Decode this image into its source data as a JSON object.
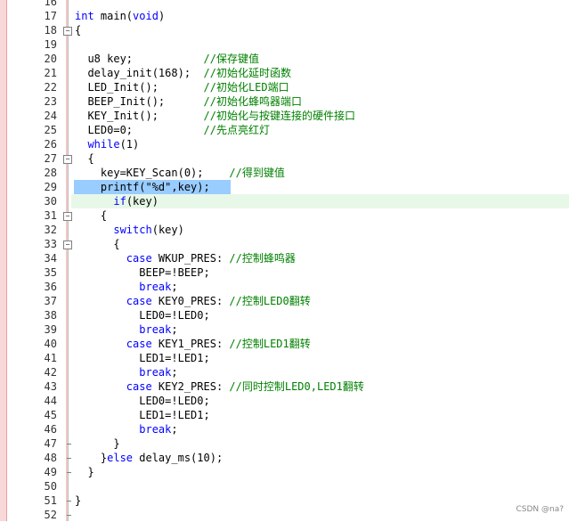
{
  "editor": {
    "lines": [
      {
        "n": "16",
        "fold": "",
        "parts": []
      },
      {
        "n": "17",
        "fold": "",
        "parts": [
          [
            "kw",
            "int"
          ],
          [
            "t",
            " main("
          ],
          [
            "kw",
            "void"
          ],
          [
            "t",
            ")"
          ]
        ]
      },
      {
        "n": "18",
        "fold": "box",
        "parts": [
          [
            "t",
            "{"
          ]
        ]
      },
      {
        "n": "19",
        "fold": "",
        "parts": []
      },
      {
        "n": "20",
        "fold": "",
        "parts": [
          [
            "t",
            "  u8 key;           "
          ],
          [
            "cm",
            "//保存键值"
          ]
        ]
      },
      {
        "n": "21",
        "fold": "",
        "parts": [
          [
            "t",
            "  delay_init(168);  "
          ],
          [
            "cm",
            "//初始化延时函数"
          ]
        ]
      },
      {
        "n": "22",
        "fold": "",
        "parts": [
          [
            "t",
            "  LED_Init();       "
          ],
          [
            "cm",
            "//初始化LED端口"
          ]
        ]
      },
      {
        "n": "23",
        "fold": "",
        "parts": [
          [
            "t",
            "  BEEP_Init();      "
          ],
          [
            "cm",
            "//初始化蜂鸣器端口"
          ]
        ]
      },
      {
        "n": "24",
        "fold": "",
        "parts": [
          [
            "t",
            "  KEY_Init();       "
          ],
          [
            "cm",
            "//初始化与按键连接的硬件接口"
          ]
        ]
      },
      {
        "n": "25",
        "fold": "",
        "parts": [
          [
            "t",
            "  LED0=0;           "
          ],
          [
            "cm",
            "//先点亮红灯"
          ]
        ]
      },
      {
        "n": "26",
        "fold": "",
        "parts": [
          [
            "t",
            "  "
          ],
          [
            "kw",
            "while"
          ],
          [
            "t",
            "(1)"
          ]
        ]
      },
      {
        "n": "27",
        "fold": "box",
        "parts": [
          [
            "t",
            "  {"
          ]
        ]
      },
      {
        "n": "28",
        "fold": "",
        "parts": [
          [
            "t",
            "    key=KEY_Scan(0);    "
          ],
          [
            "cm",
            "//得到键值"
          ]
        ]
      },
      {
        "n": "29",
        "fold": "",
        "parts": [
          [
            "t",
            "    printf(\"%d\",key);"
          ]
        ]
      },
      {
        "n": "30",
        "fold": "",
        "parts": [
          [
            "t",
            "      "
          ],
          [
            "kw",
            "if"
          ],
          [
            "t",
            "(key)"
          ]
        ]
      },
      {
        "n": "31",
        "fold": "box",
        "parts": [
          [
            "t",
            "    {"
          ]
        ]
      },
      {
        "n": "32",
        "fold": "",
        "parts": [
          [
            "t",
            "      "
          ],
          [
            "kw",
            "switch"
          ],
          [
            "t",
            "(key)"
          ]
        ]
      },
      {
        "n": "33",
        "fold": "box",
        "parts": [
          [
            "t",
            "      {"
          ]
        ]
      },
      {
        "n": "34",
        "fold": "",
        "parts": [
          [
            "t",
            "        "
          ],
          [
            "kw",
            "case"
          ],
          [
            "t",
            " WKUP_PRES: "
          ],
          [
            "cm",
            "//控制蜂鸣器"
          ]
        ]
      },
      {
        "n": "35",
        "fold": "",
        "parts": [
          [
            "t",
            "          BEEP=!BEEP;"
          ]
        ]
      },
      {
        "n": "36",
        "fold": "",
        "parts": [
          [
            "t",
            "          "
          ],
          [
            "kw",
            "break"
          ],
          [
            "t",
            ";"
          ]
        ]
      },
      {
        "n": "37",
        "fold": "",
        "parts": [
          [
            "t",
            "        "
          ],
          [
            "kw",
            "case"
          ],
          [
            "t",
            " KEY0_PRES: "
          ],
          [
            "cm",
            "//控制LED0翻转"
          ]
        ]
      },
      {
        "n": "38",
        "fold": "",
        "parts": [
          [
            "t",
            "          LED0=!LED0;"
          ]
        ]
      },
      {
        "n": "39",
        "fold": "",
        "parts": [
          [
            "t",
            "          "
          ],
          [
            "kw",
            "break"
          ],
          [
            "t",
            ";"
          ]
        ]
      },
      {
        "n": "40",
        "fold": "",
        "parts": [
          [
            "t",
            "        "
          ],
          [
            "kw",
            "case"
          ],
          [
            "t",
            " KEY1_PRES: "
          ],
          [
            "cm",
            "//控制LED1翻转"
          ]
        ]
      },
      {
        "n": "41",
        "fold": "",
        "parts": [
          [
            "t",
            "          LED1=!LED1;"
          ]
        ]
      },
      {
        "n": "42",
        "fold": "",
        "parts": [
          [
            "t",
            "          "
          ],
          [
            "kw",
            "break"
          ],
          [
            "t",
            ";"
          ]
        ]
      },
      {
        "n": "43",
        "fold": "",
        "parts": [
          [
            "t",
            "        "
          ],
          [
            "kw",
            "case"
          ],
          [
            "t",
            " KEY2_PRES: "
          ],
          [
            "cm",
            "//同时控制LED0,LED1翻转"
          ]
        ]
      },
      {
        "n": "44",
        "fold": "",
        "parts": [
          [
            "t",
            "          LED0=!LED0;"
          ]
        ]
      },
      {
        "n": "45",
        "fold": "",
        "parts": [
          [
            "t",
            "          LED1=!LED1;"
          ]
        ]
      },
      {
        "n": "46",
        "fold": "",
        "parts": [
          [
            "t",
            "          "
          ],
          [
            "kw",
            "break"
          ],
          [
            "t",
            ";"
          ]
        ]
      },
      {
        "n": "47",
        "fold": "end",
        "parts": [
          [
            "t",
            "      }"
          ]
        ]
      },
      {
        "n": "48",
        "fold": "end",
        "parts": [
          [
            "t",
            "    }"
          ],
          [
            "kw",
            "else"
          ],
          [
            "t",
            " delay_ms(10);"
          ]
        ]
      },
      {
        "n": "49",
        "fold": "end",
        "parts": [
          [
            "t",
            "  }"
          ]
        ]
      },
      {
        "n": "50",
        "fold": "",
        "parts": []
      },
      {
        "n": "51",
        "fold": "end",
        "parts": [
          [
            "t",
            "}"
          ]
        ]
      },
      {
        "n": "52",
        "fold": "end",
        "parts": []
      }
    ],
    "current_line": "30",
    "selected_line": "29"
  },
  "watermark": "CSDN @na?",
  "colors": {
    "keyword": "#0000ff",
    "comment": "#008000",
    "selection": "#99ccff",
    "current_line": "#e8f8e8"
  }
}
